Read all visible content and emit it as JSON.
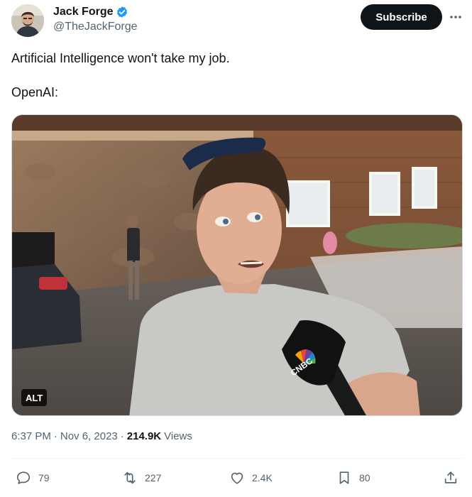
{
  "author": {
    "display_name": "Jack Forge",
    "handle": "@TheJackForge",
    "verified": true,
    "verified_color": "#1d9bf0"
  },
  "header": {
    "subscribe_label": "Subscribe",
    "more_icon": "more-horizontal-icon"
  },
  "tweet": {
    "text_lines": [
      "Artificial Intelligence won't take my job.",
      "OpenAI:"
    ]
  },
  "media": {
    "alt_label": "ALT",
    "mic_logo_text": "CNBC"
  },
  "meta": {
    "time": "6:37 PM",
    "separator": "·",
    "date": "Nov 6, 2023",
    "views_count": "214.9K",
    "views_label": "Views"
  },
  "actions": {
    "reply": {
      "icon": "reply-icon",
      "count": "79"
    },
    "retweet": {
      "icon": "retweet-icon",
      "count": "227"
    },
    "like": {
      "icon": "heart-icon",
      "count": "2.4K"
    },
    "bookmark": {
      "icon": "bookmark-icon",
      "count": "80"
    },
    "share": {
      "icon": "share-icon"
    }
  },
  "colors": {
    "text_primary": "#0f1419",
    "text_secondary": "#536471",
    "button_bg": "#0f1419"
  }
}
